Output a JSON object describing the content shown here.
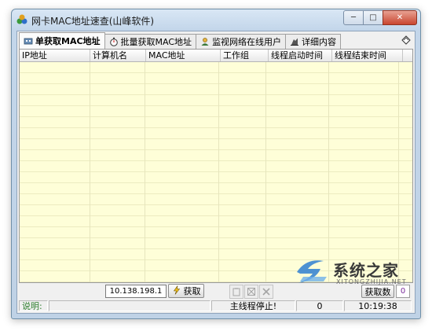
{
  "window": {
    "title": "网卡MAC地址速查(山峰软件)",
    "controls": {
      "minimize": "─",
      "maximize": "□",
      "close": "✕"
    }
  },
  "tabs": [
    {
      "label": "单获取MAC地址",
      "icon": "network-card-icon",
      "active": true
    },
    {
      "label": "批量获取MAC地址",
      "icon": "stopwatch-icon",
      "active": false
    },
    {
      "label": "监视网络在线用户",
      "icon": "user-monitor-icon",
      "active": false
    },
    {
      "label": "详细内容",
      "icon": "details-icon",
      "active": false
    }
  ],
  "table": {
    "columns": [
      "IP地址",
      "计算机名",
      "MAC地址",
      "工作组",
      "线程启动时间",
      "线程结束时间"
    ],
    "rows": []
  },
  "toolbar": {
    "ip_value": "10.138.198.1",
    "fetch_label": "获取",
    "fetch_count_label": "获取数",
    "count_value": "0"
  },
  "status": {
    "description_label": "说明:",
    "thread_status": "主线程停止!",
    "count": "0",
    "time": "10:19:38"
  },
  "watermark": {
    "name": "系统之家",
    "url": "XITONGZHIJIA.NET"
  },
  "colors": {
    "list_background": "#fefed8",
    "accent_blue": "#2f7fd1"
  }
}
